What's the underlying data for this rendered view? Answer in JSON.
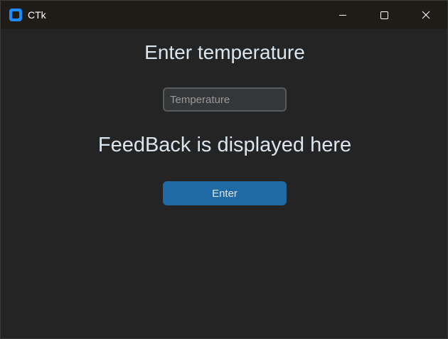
{
  "window": {
    "title": "CTk"
  },
  "main": {
    "heading": "Enter temperature",
    "temperature_input": {
      "value": "",
      "placeholder": "Temperature"
    },
    "feedback": "FeedBack is displayed here",
    "enter_button_label": "Enter"
  },
  "icons": {
    "app": "ctk-app-icon",
    "minimize": "minimize-icon",
    "maximize": "maximize-icon",
    "close": "close-icon"
  },
  "colors": {
    "window_bg": "#242424",
    "titlebar_bg": "#1f1c17",
    "accent": "#1f6aa5",
    "app_icon": "#1a8cff",
    "text": "#dce4ee"
  }
}
